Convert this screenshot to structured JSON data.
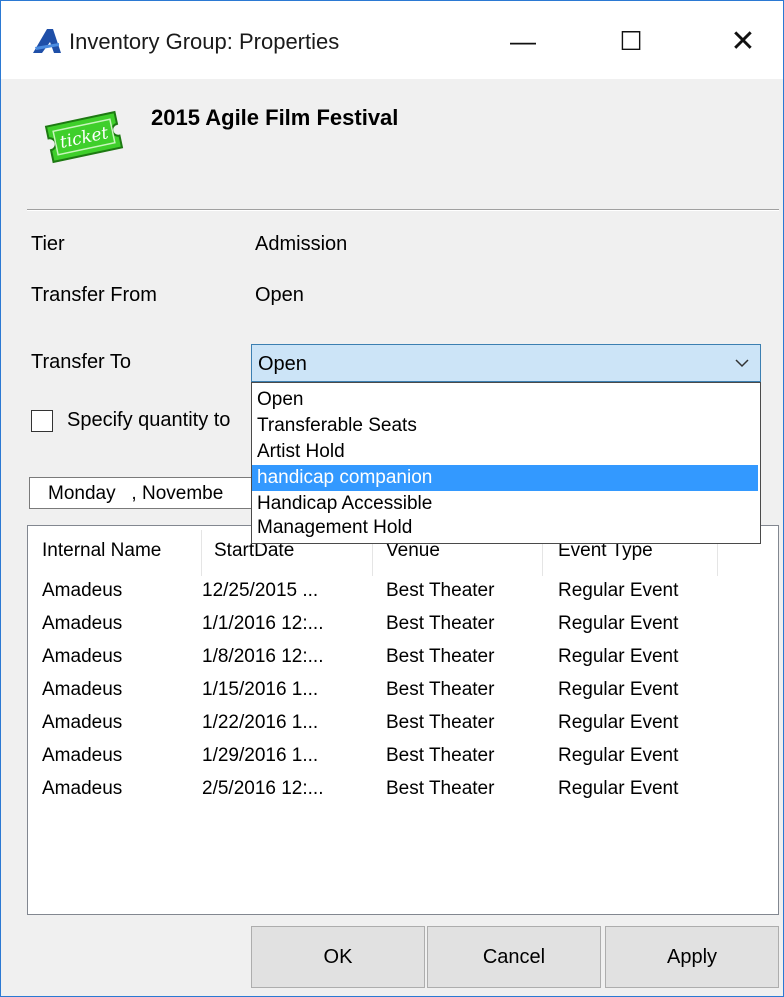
{
  "window": {
    "title": "Inventory Group: Properties",
    "minimize_glyph": "—",
    "maximize_glyph": "☐",
    "close_glyph": "✕"
  },
  "header": {
    "group_name": "2015 Agile Film Festival",
    "ticket_text": "ticket"
  },
  "fields": {
    "tier_label": "Tier",
    "tier_value": "Admission",
    "transfer_from_label": "Transfer From",
    "transfer_from_value": "Open",
    "transfer_to_label": "Transfer To",
    "transfer_to_value": "Open",
    "specify_quantity_label": "Specify quantity to",
    "date_value": "Monday   , Novembe"
  },
  "dropdown": {
    "options": [
      "Open",
      "Transferable Seats",
      "Artist Hold",
      "handicap companion",
      "Handicap Accessible",
      "Management Hold"
    ],
    "selected_index": 3
  },
  "table": {
    "columns": [
      "Internal Name",
      "StartDate",
      "Venue",
      "Event Type"
    ],
    "rows": [
      [
        "Amadeus",
        "12/25/2015 ...",
        "Best Theater",
        "Regular Event"
      ],
      [
        "Amadeus",
        "1/1/2016 12:...",
        "Best Theater",
        "Regular Event"
      ],
      [
        "Amadeus",
        "1/8/2016 12:...",
        "Best Theater",
        "Regular Event"
      ],
      [
        "Amadeus",
        "1/15/2016 1...",
        "Best Theater",
        "Regular Event"
      ],
      [
        "Amadeus",
        "1/22/2016 1...",
        "Best Theater",
        "Regular Event"
      ],
      [
        "Amadeus",
        "1/29/2016 1...",
        "Best Theater",
        "Regular Event"
      ],
      [
        "Amadeus",
        "2/5/2016 12:...",
        "Best Theater",
        "Regular Event"
      ]
    ]
  },
  "buttons": {
    "ok": "OK",
    "cancel": "Cancel",
    "apply": "Apply"
  },
  "colors": {
    "accent": "#3399ff",
    "combo_bg": "#cce4f7",
    "window_border": "#2b79d3",
    "ticket_green": "#3fcf2b"
  },
  "icons": {
    "app": "app-logo-icon",
    "ticket": "ticket-icon",
    "dropdown": "chevron-down-icon"
  }
}
